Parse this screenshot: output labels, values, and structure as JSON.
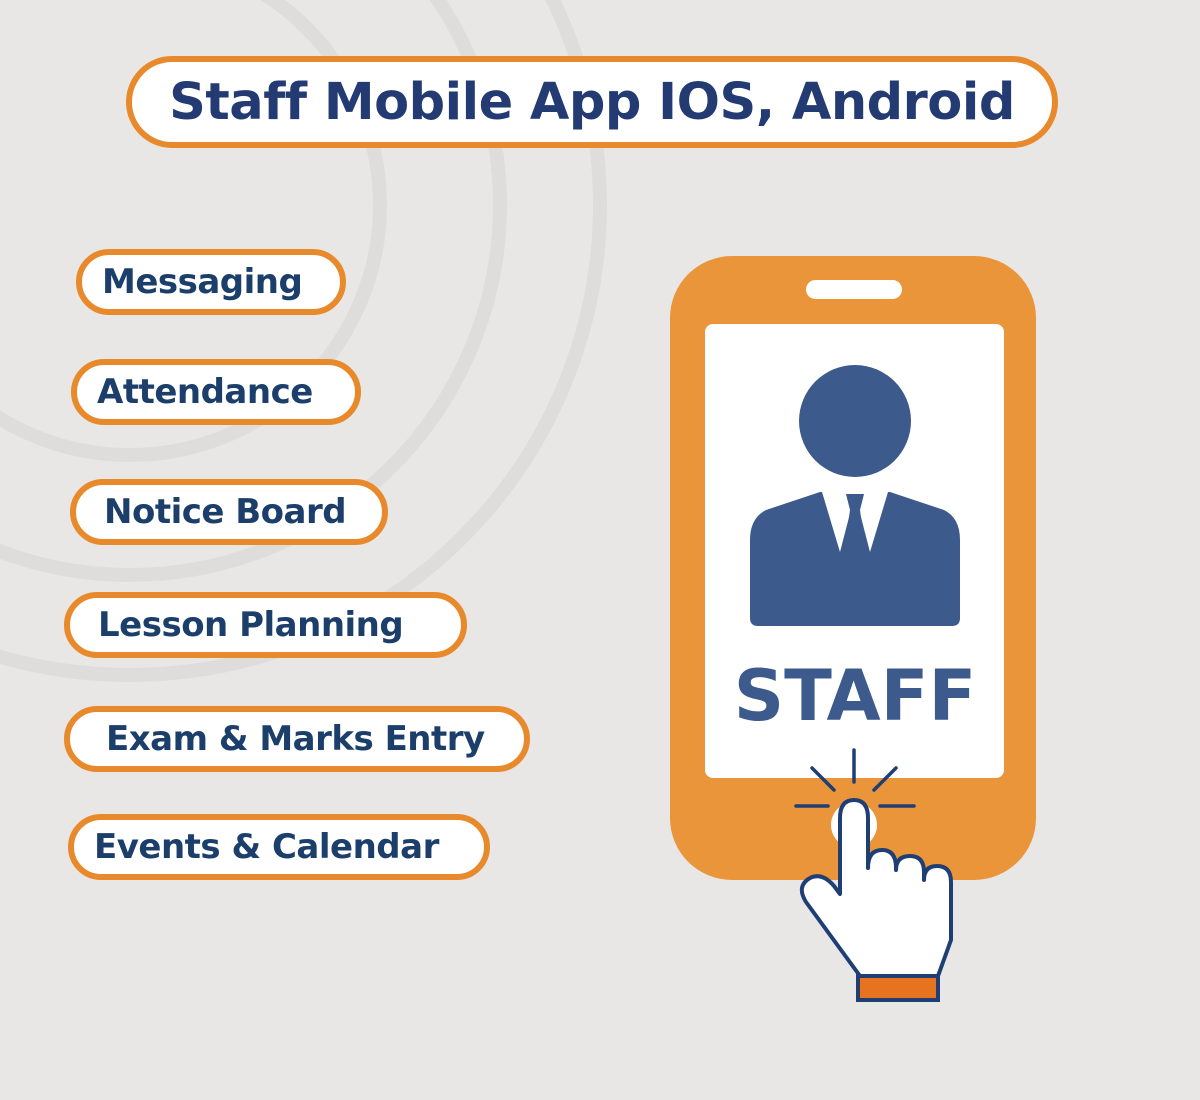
{
  "title": "Staff Mobile App IOS, Android",
  "features": [
    {
      "label": "Messaging"
    },
    {
      "label": "Attendance"
    },
    {
      "label": "Notice Board"
    },
    {
      "label": "Lesson Planning"
    },
    {
      "label": "Exam & Marks Entry"
    },
    {
      "label": "Events & Calendar"
    }
  ],
  "phone": {
    "screen_label": "STAFF",
    "icons": [
      "staff-person-icon",
      "tapping-hand-icon"
    ]
  },
  "colors": {
    "background": "#e8e7e6",
    "accent_orange": "#e88a2b",
    "phone_orange": "#eb953b",
    "navy": "#233a72",
    "person_blue": "#3d5a8c"
  }
}
